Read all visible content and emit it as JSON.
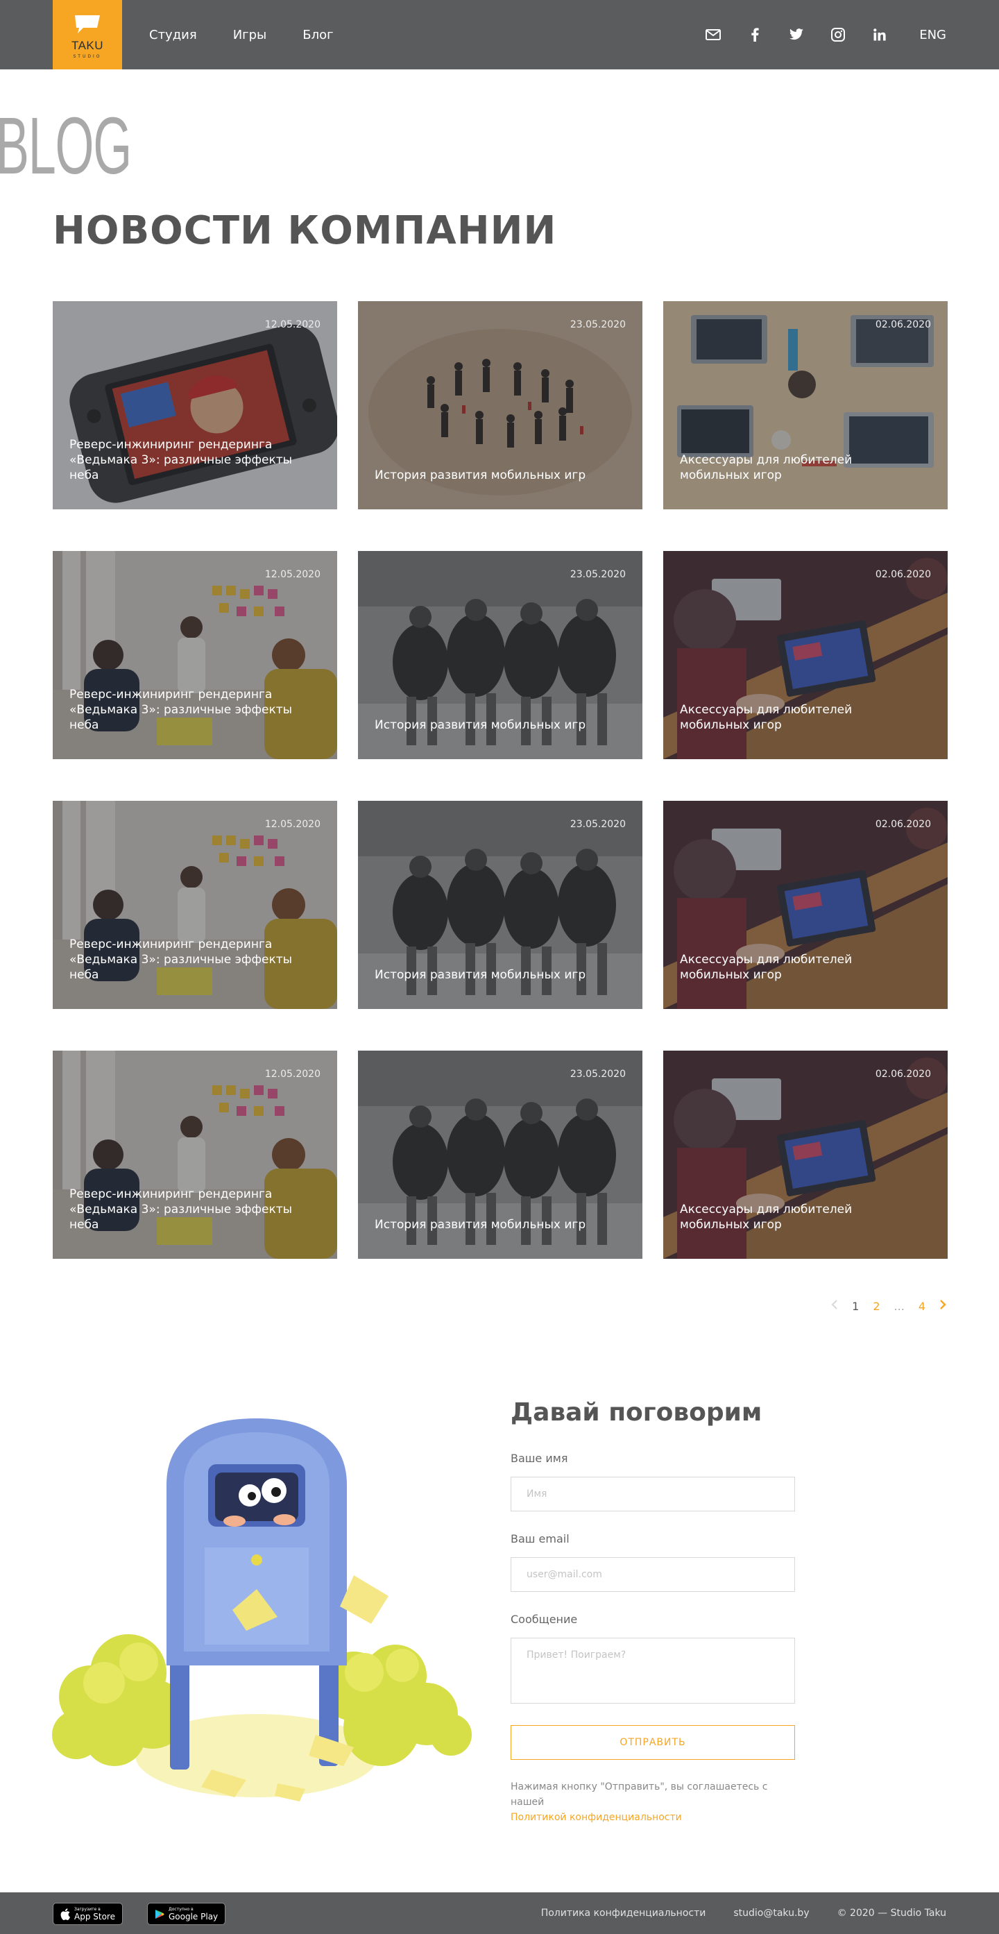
{
  "header": {
    "logo_text": "TAKU",
    "logo_sub": "STUDIO",
    "nav": [
      "Студия",
      "Игры",
      "Блог"
    ],
    "lang": "ENG",
    "icons": [
      "mail-icon",
      "facebook-icon",
      "twitter-icon",
      "instagram-icon",
      "linkedin-icon"
    ]
  },
  "blog": {
    "watermark": "BLOG",
    "title": "НОВОСТИ КОМПАНИИ"
  },
  "cards": [
    {
      "date": "12.05.2020",
      "title": "Реверс-инжиниринг рендеринга «Ведьмака 3»: различные эффекты неба",
      "scene": "handheld-console"
    },
    {
      "date": "23.05.2020",
      "title": "История развития мобильных игр",
      "scene": "sand-team"
    },
    {
      "date": "02.06.2020",
      "title": "Аксессуары для любителей мобильных игор",
      "scene": "desk-laptops"
    },
    {
      "date": "12.05.2020",
      "title": "Реверс-инжиниринг рендеринга «Ведьмака 3»: различные эффекты неба",
      "scene": "office-meeting"
    },
    {
      "date": "23.05.2020",
      "title": "История развития мобильных игр",
      "scene": "rugby-scrum"
    },
    {
      "date": "02.06.2020",
      "title": "Аксессуары для любителей мобильных игор",
      "scene": "laptop-table"
    },
    {
      "date": "12.05.2020",
      "title": "Реверс-инжиниринг рендеринга «Ведьмака 3»: различные эффекты неба",
      "scene": "office-meeting"
    },
    {
      "date": "23.05.2020",
      "title": "История развития мобильных игр",
      "scene": "rugby-scrum"
    },
    {
      "date": "02.06.2020",
      "title": "Аксессуары для любителей мобильных игор",
      "scene": "laptop-table"
    },
    {
      "date": "12.05.2020",
      "title": "Реверс-инжиниринг рендеринга «Ведьмака 3»: различные эффекты неба",
      "scene": "office-meeting"
    },
    {
      "date": "23.05.2020",
      "title": "История развития мобильных игр",
      "scene": "rugby-scrum"
    },
    {
      "date": "02.06.2020",
      "title": "Аксессуары для любителей мобильных игор",
      "scene": "laptop-table"
    }
  ],
  "pagination": {
    "pages": [
      {
        "label": "1",
        "current": true
      },
      {
        "label": "2",
        "current": false
      },
      {
        "label": "...",
        "current": false
      },
      {
        "label": "4",
        "current": false
      }
    ]
  },
  "contact": {
    "title": "Давай поговорим",
    "name_label": "Ваше имя",
    "name_placeholder": "Имя",
    "email_label": "Ваш email",
    "email_placeholder": "user@mail.com",
    "message_label": "Сообщение",
    "message_placeholder": "Привет! Поиграем?",
    "submit": "ОТПРАВИТЬ",
    "consent_text": "Нажимая кнопку \"Отправить\", вы соглашаетесь с нашей",
    "consent_link": "Политикой конфиденциальности"
  },
  "footer": {
    "appstore_small": "Загрузите в",
    "appstore_big": "App Store",
    "googleplay_small": "Доступно в",
    "googleplay_big": "Google Play",
    "privacy": "Политика конфиденциальности",
    "email": "studio@taku.by",
    "copyright": "© 2020 — Studio Taku"
  },
  "colors": {
    "accent": "#f6a623",
    "header_bg": "#5b5c5e",
    "text": "#555555"
  }
}
